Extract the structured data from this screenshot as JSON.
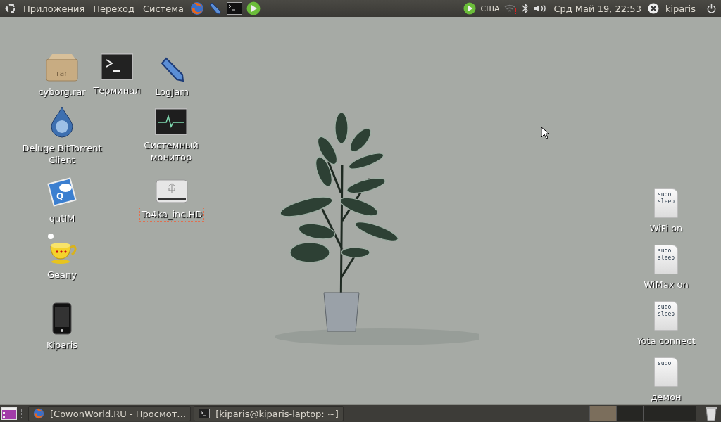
{
  "top_panel": {
    "menus": [
      "Приложения",
      "Переход",
      "Система"
    ],
    "keyboard_layout": "США",
    "clock": "Срд Май 19, 22:53",
    "user": "kiparis"
  },
  "desktop_icons": [
    {
      "label": "cyborg.rar",
      "kind": "archive",
      "icon_text": "rar",
      "focused": false
    },
    {
      "label": "Терминал",
      "kind": "terminal",
      "focused": false
    },
    {
      "label": "LogJam",
      "kind": "pencil",
      "focused": false
    },
    {
      "label": "Deluge BitTorrent Client",
      "kind": "droplet",
      "focused": false
    },
    {
      "label": "Системный монитор",
      "kind": "monitor",
      "focused": false
    },
    {
      "label": "qutIM",
      "kind": "chat",
      "icon_text": "Q",
      "focused": false
    },
    {
      "label": "To4ka_inc.HD",
      "kind": "drive",
      "focused": true
    },
    {
      "label": "Geany",
      "kind": "teapot",
      "focused": false
    },
    {
      "label": "Kiparis",
      "kind": "phone",
      "focused": false
    },
    {
      "label": "WiFi on",
      "kind": "script",
      "preview": [
        "sudo",
        "sleep"
      ],
      "focused": false
    },
    {
      "label": "WiMax on",
      "kind": "script",
      "preview": [
        "sudo",
        "sleep"
      ],
      "focused": false
    },
    {
      "label": "Yota connect",
      "kind": "script",
      "preview": [
        "sudo",
        "sleep"
      ],
      "focused": false
    },
    {
      "label": "демон",
      "kind": "script",
      "preview": [
        "sudo"
      ],
      "focused": false
    }
  ],
  "taskbar": {
    "tasks": [
      {
        "title": "[CowonWorld.RU - Просмот…",
        "kind": "browser"
      },
      {
        "title": "[kiparis@kiparis-laptop: ~]",
        "kind": "terminal"
      }
    ],
    "workspaces": [
      {
        "selected": true
      },
      {
        "selected": false
      },
      {
        "selected": false
      },
      {
        "selected": false
      }
    ]
  }
}
